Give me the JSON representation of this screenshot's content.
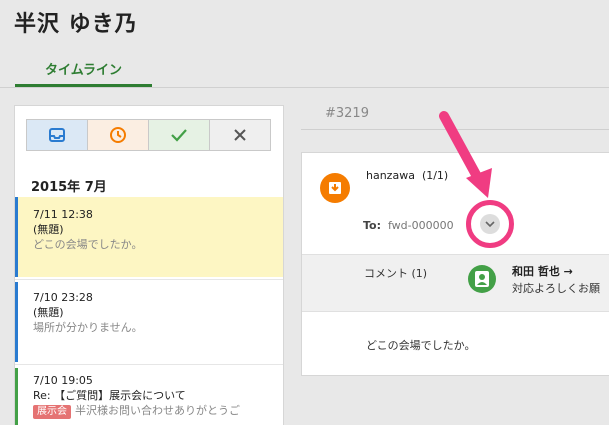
{
  "header": {
    "title": "半沢 ゆき乃",
    "tab_label": "タイムライン"
  },
  "filters": [
    {
      "icon": "inbox-icon",
      "color": "#2a7bd0"
    },
    {
      "icon": "clock-icon",
      "color": "#f57c00"
    },
    {
      "icon": "check-icon",
      "color": "#43a047"
    },
    {
      "icon": "close-icon",
      "color": "#555555"
    }
  ],
  "timeline": {
    "month": "2015年 7月",
    "items": [
      {
        "time": "7/11 12:38",
        "subject": "(無題)",
        "body": "どこの会場でしたか。"
      },
      {
        "time": "7/10 23:28",
        "subject": "(無題)",
        "body": "場所が分かりません。"
      },
      {
        "time": "7/10 19:05",
        "subject": "Re: 【ご質問】展示会について",
        "tag": "展示会",
        "body": "半沢様お問い合わせありがとうご"
      }
    ]
  },
  "ticket": {
    "id": "#3219",
    "sender": "hanzawa",
    "sender_count": "(1/1)",
    "to_label": "To:",
    "to_value": "fwd-000000",
    "comment_label": "コメント (1)",
    "comment_author": "和田 哲也 → ",
    "comment_text": "対応よろしくお願",
    "message_body": "どこの会場でしたか。"
  },
  "colors": {
    "accent_green": "#2e7d32",
    "highlight_pink": "#f03c82",
    "item_selected_bg": "#fdf6c3"
  }
}
